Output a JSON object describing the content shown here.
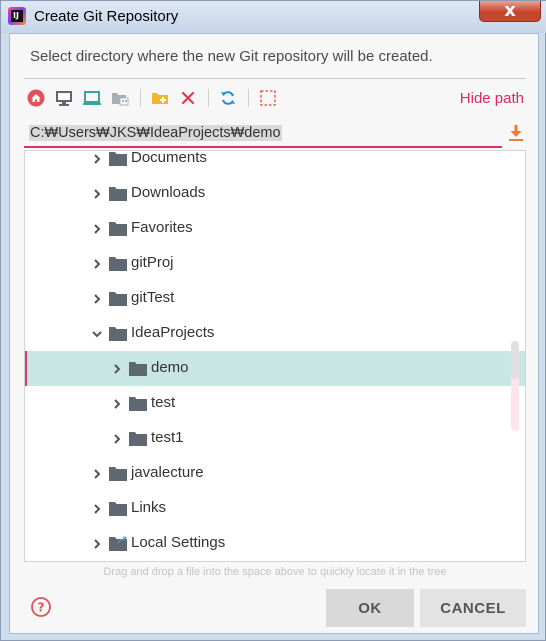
{
  "window": {
    "title": "Create Git Repository",
    "close_glyph": "x"
  },
  "description": "Select directory where the new Git repository will be created.",
  "toolbar": {
    "buttons": [
      {
        "name": "home-icon"
      },
      {
        "name": "desktop-icon"
      },
      {
        "name": "project-icon"
      },
      {
        "name": "module-icon"
      },
      {
        "name": "new-folder-icon"
      },
      {
        "name": "delete-icon"
      },
      {
        "name": "refresh-icon"
      },
      {
        "name": "toggle-hidden-icon"
      }
    ],
    "hide_path_label": "Hide path"
  },
  "path": {
    "value": "C:₩Users₩JKS₩IdeaProjects₩demo"
  },
  "tree": {
    "items": [
      {
        "label": "Documents",
        "expanded": false,
        "selected": false,
        "icon": "folder-icon"
      },
      {
        "label": "Downloads",
        "expanded": false,
        "selected": false,
        "icon": "folder-icon"
      },
      {
        "label": "Favorites",
        "expanded": false,
        "selected": false,
        "icon": "folder-icon"
      },
      {
        "label": "gitProj",
        "expanded": false,
        "selected": false,
        "icon": "folder-icon"
      },
      {
        "label": "gitTest",
        "expanded": false,
        "selected": false,
        "icon": "folder-icon"
      },
      {
        "label": "IdeaProjects",
        "expanded": true,
        "selected": false,
        "icon": "folder-icon"
      },
      {
        "label": "demo",
        "expanded": false,
        "selected": true,
        "icon": "folder-icon"
      },
      {
        "label": "test",
        "expanded": false,
        "selected": false,
        "icon": "folder-icon"
      },
      {
        "label": "test1",
        "expanded": false,
        "selected": false,
        "icon": "folder-icon"
      },
      {
        "label": "javalecture",
        "expanded": false,
        "selected": false,
        "icon": "folder-icon"
      },
      {
        "label": "Links",
        "expanded": false,
        "selected": false,
        "icon": "folder-icon"
      },
      {
        "label": "Local Settings",
        "expanded": false,
        "selected": false,
        "icon": "shortcut-folder-icon"
      }
    ]
  },
  "hint": "Drag and drop a file into the space above to quickly locate it in the tree",
  "buttons": {
    "ok_label": "OK",
    "cancel_label": "CANCEL"
  },
  "colors": {
    "accent": "#d63566",
    "selection": "#c8e6e2",
    "folder": "#5f6870"
  }
}
